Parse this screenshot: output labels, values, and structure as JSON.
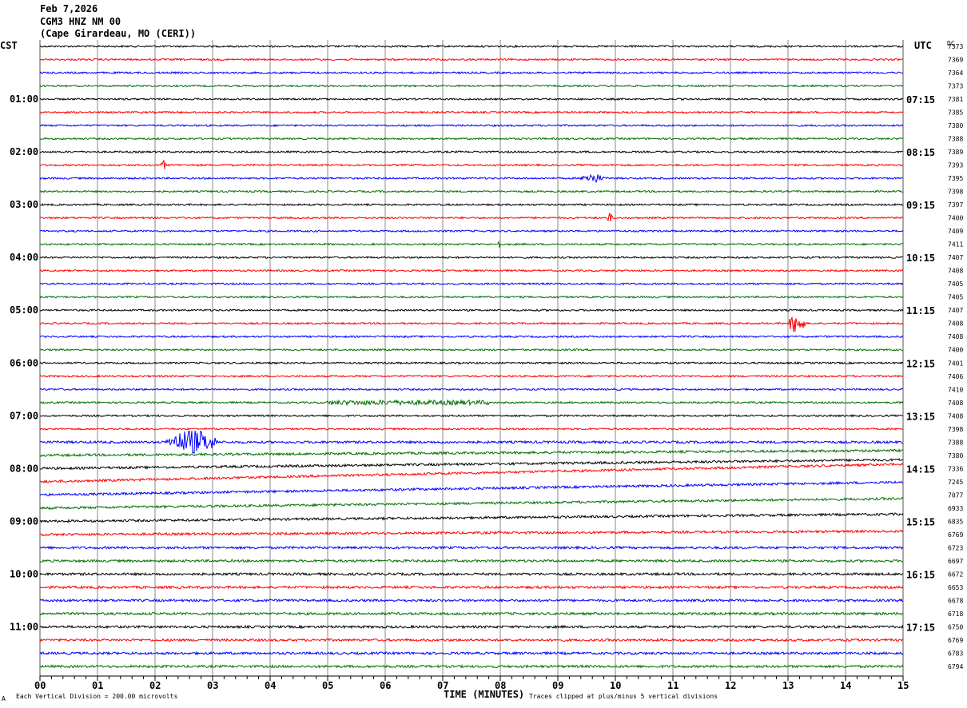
{
  "header": {
    "date": "Feb 7,2026",
    "station": "CGM3 HNZ NM 00",
    "location": "(Cape Girardeau, MO (CERI))",
    "left_tz": "CST",
    "right_tz": "UTC",
    "dc_label": "DC"
  },
  "footer": {
    "scale_note": "Each Vertical Division =  200.00 microvolts",
    "xlabel": "TIME (MINUTES)",
    "clip_note": "Traces clipped at plus/minus 5 vertical divisions",
    "logo_text": "A"
  },
  "chart_data": {
    "type": "line",
    "subtype": "helicorder",
    "xlabel": "TIME (MINUTES)",
    "xlim": [
      0,
      15
    ],
    "x_ticks": [
      "00",
      "01",
      "02",
      "03",
      "04",
      "05",
      "06",
      "07",
      "08",
      "09",
      "10",
      "11",
      "12",
      "13",
      "14",
      "15"
    ],
    "grid": true,
    "trace_colors": [
      "#000000",
      "#ff0000",
      "#0000ff",
      "#007000"
    ],
    "left_labels": [
      {
        "trace": 4,
        "text": "01:00"
      },
      {
        "trace": 8,
        "text": "02:00"
      },
      {
        "trace": 12,
        "text": "03:00"
      },
      {
        "trace": 16,
        "text": "04:00"
      },
      {
        "trace": 20,
        "text": "05:00"
      },
      {
        "trace": 24,
        "text": "06:00"
      },
      {
        "trace": 28,
        "text": "07:00"
      },
      {
        "trace": 32,
        "text": "08:00"
      },
      {
        "trace": 36,
        "text": "09:00"
      },
      {
        "trace": 40,
        "text": "10:00"
      },
      {
        "trace": 44,
        "text": "11:00"
      }
    ],
    "right_labels": [
      {
        "trace": 4,
        "text": "07:15"
      },
      {
        "trace": 8,
        "text": "08:15"
      },
      {
        "trace": 12,
        "text": "09:15"
      },
      {
        "trace": 16,
        "text": "10:15"
      },
      {
        "trace": 20,
        "text": "11:15"
      },
      {
        "trace": 24,
        "text": "12:15"
      },
      {
        "trace": 28,
        "text": "13:15"
      },
      {
        "trace": 32,
        "text": "14:15"
      },
      {
        "trace": 36,
        "text": "15:15"
      },
      {
        "trace": 40,
        "text": "16:15"
      },
      {
        "trace": 44,
        "text": "17:15"
      }
    ],
    "dc_values": [
      "7373",
      "7369",
      "7364",
      "7373",
      "7381",
      "7385",
      "7380",
      "7388",
      "7389",
      "7393",
      "7395",
      "7398",
      "7397",
      "7400",
      "7409",
      "7411",
      "7407",
      "7408",
      "7405",
      "7405",
      "7407",
      "7408",
      "7408",
      "7400",
      "7401",
      "7406",
      "7410",
      "7408",
      "7408",
      "7398",
      "7388",
      "7380",
      "7336",
      "7245",
      "7077",
      "6933",
      "6835",
      "6769",
      "6723",
      "6697",
      "6672",
      "6653",
      "6678",
      "6718",
      "6750",
      "6769",
      "6783",
      "6794"
    ],
    "events": [
      {
        "trace": 9,
        "start_min": 2.1,
        "end_min": 2.2,
        "size": "small"
      },
      {
        "trace": 10,
        "start_min": 9.4,
        "end_min": 9.8,
        "size": "small"
      },
      {
        "trace": 13,
        "start_min": 9.85,
        "end_min": 9.95,
        "size": "small"
      },
      {
        "trace": 15,
        "start_min": 7.95,
        "end_min": 8.0,
        "size": "small"
      },
      {
        "trace": 21,
        "start_min": 13.0,
        "end_min": 13.3,
        "size": "medium"
      },
      {
        "trace": 27,
        "start_min": 5.0,
        "end_min": 7.8,
        "size": "noise"
      },
      {
        "trace": 30,
        "start_min": 2.2,
        "end_min": 3.1,
        "size": "large"
      }
    ]
  }
}
